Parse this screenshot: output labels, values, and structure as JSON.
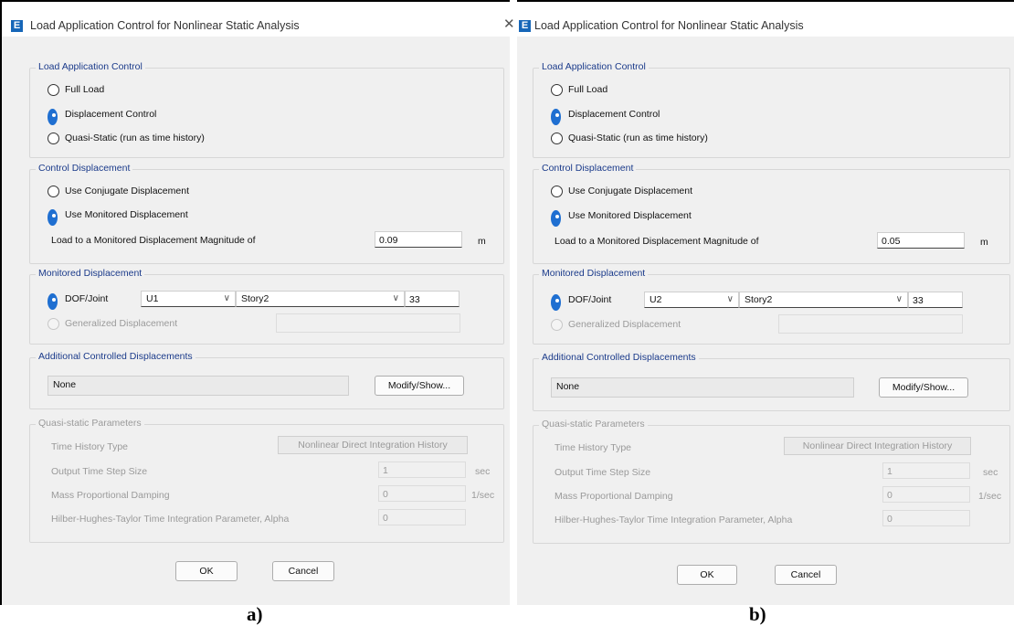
{
  "app_icon": "E",
  "panels": [
    {
      "title": "Load Application Control for Nonlinear Static Analysis",
      "caption": "a)",
      "lac": {
        "heading": "Load Application Control",
        "full_load": "Full Load",
        "displacement_control": "Displacement Control",
        "quasi_static": "Quasi-Static (run as time history)",
        "selected": "Displacement Control"
      },
      "cd": {
        "heading": "Control Displacement",
        "conjugate": "Use Conjugate Displacement",
        "monitored": "Use Monitored Displacement",
        "selected": "Use Monitored Displacement",
        "magnitude_label": "Load to a Monitored Displacement Magnitude of",
        "magnitude_value": "0.09",
        "unit": "m"
      },
      "md": {
        "heading": "Monitored Displacement",
        "dof_joint": "DOF/Joint",
        "dof": "U1",
        "story": "Story2",
        "joint": "33",
        "generalized": "Generalized Displacement",
        "generalized_value": ""
      },
      "acd": {
        "heading": "Additional Controlled Displacements",
        "value": "None",
        "modify_show": "Modify/Show..."
      },
      "qs": {
        "heading": "Quasi-static Parameters",
        "th_type_label": "Time History Type",
        "th_type_value": "Nonlinear Direct Integration History",
        "step_label": "Output Time Step Size",
        "step_value": "1",
        "step_unit": "sec",
        "mass_label": "Mass Proportional Damping",
        "mass_value": "0",
        "mass_unit": "1/sec",
        "hht_label": "Hilber-Hughes-Taylor Time Integration Parameter, Alpha",
        "hht_value": "0"
      },
      "ok": "OK",
      "cancel": "Cancel"
    },
    {
      "title": "Load Application Control for Nonlinear Static Analysis",
      "caption": "b)",
      "lac": {
        "heading": "Load Application Control",
        "full_load": "Full Load",
        "displacement_control": "Displacement Control",
        "quasi_static": "Quasi-Static (run as time history)",
        "selected": "Displacement Control"
      },
      "cd": {
        "heading": "Control Displacement",
        "conjugate": "Use Conjugate Displacement",
        "monitored": "Use Monitored Displacement",
        "selected": "Use Monitored Displacement",
        "magnitude_label": "Load to a Monitored Displacement Magnitude of",
        "magnitude_value": "0.05",
        "unit": "m"
      },
      "md": {
        "heading": "Monitored Displacement",
        "dof_joint": "DOF/Joint",
        "dof": "U2",
        "story": "Story2",
        "joint": "33",
        "generalized": "Generalized Displacement",
        "generalized_value": ""
      },
      "acd": {
        "heading": "Additional Controlled Displacements",
        "value": "None",
        "modify_show": "Modify/Show..."
      },
      "qs": {
        "heading": "Quasi-static Parameters",
        "th_type_label": "Time History Type",
        "th_type_value": "Nonlinear Direct Integration History",
        "step_label": "Output Time Step Size",
        "step_value": "1",
        "step_unit": "sec",
        "mass_label": "Mass Proportional Damping",
        "mass_value": "0",
        "mass_unit": "1/sec",
        "hht_label": "Hilber-Hughes-Taylor Time Integration Parameter, Alpha",
        "hht_value": "0"
      },
      "ok": "OK",
      "cancel": "Cancel"
    }
  ],
  "icons": {
    "app": "etabs-app-icon",
    "close": "close-icon",
    "dropdown": "chevron-down-icon"
  },
  "colors": {
    "accent": "#1f6fd1",
    "group_heading": "#1a3a8a",
    "disabled_text": "#9a9a9a",
    "dialog_bg": "#f0f0f0"
  }
}
